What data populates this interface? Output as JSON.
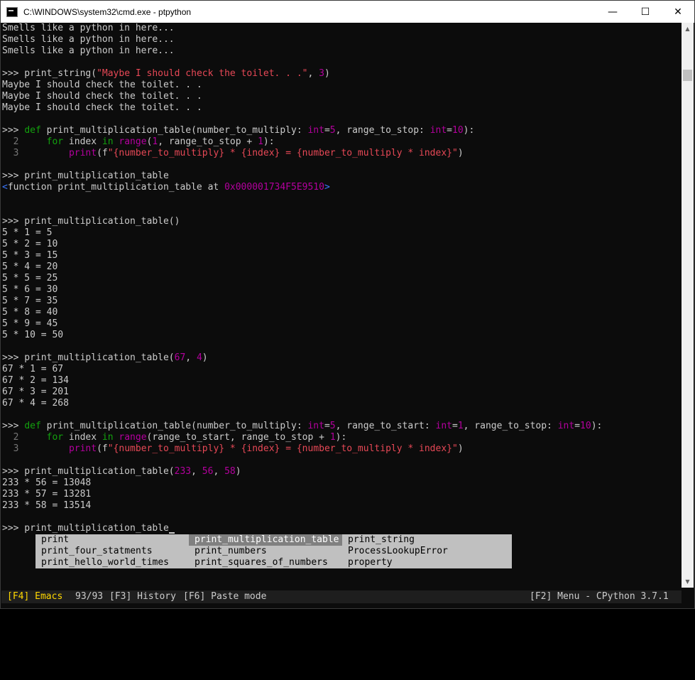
{
  "window": {
    "title": "C:\\WINDOWS\\system32\\cmd.exe - ptpython",
    "minimize": "—",
    "maximize": "☐",
    "close": "✕"
  },
  "terminal": {
    "lines": [
      {
        "segs": [
          {
            "t": "Smells like a python in here..."
          }
        ]
      },
      {
        "segs": [
          {
            "t": "Smells like a python in here..."
          }
        ]
      },
      {
        "segs": [
          {
            "t": "Smells like a python in here..."
          }
        ]
      },
      {
        "segs": []
      },
      {
        "segs": [
          {
            "t": ">>> print_string("
          },
          {
            "t": "\"Maybe I should check the toilet. . .\"",
            "c": "red"
          },
          {
            "t": ", "
          },
          {
            "t": "3",
            "c": "purple"
          },
          {
            "t": ")"
          }
        ]
      },
      {
        "segs": [
          {
            "t": "Maybe I should check the toilet. . ."
          }
        ]
      },
      {
        "segs": [
          {
            "t": "Maybe I should check the toilet. . ."
          }
        ]
      },
      {
        "segs": [
          {
            "t": "Maybe I should check the toilet. . ."
          }
        ]
      },
      {
        "segs": []
      },
      {
        "segs": [
          {
            "t": ">>> "
          },
          {
            "t": "def",
            "c": "green"
          },
          {
            "t": " print_multiplication_table(number_to_multiply: "
          },
          {
            "t": "int",
            "c": "purple"
          },
          {
            "t": "="
          },
          {
            "t": "5",
            "c": "purple"
          },
          {
            "t": ", range_to_stop: "
          },
          {
            "t": "int",
            "c": "purple"
          },
          {
            "t": "="
          },
          {
            "t": "10",
            "c": "purple"
          },
          {
            "t": "):"
          }
        ]
      },
      {
        "segs": [
          {
            "t": "  2",
            "c": "lnum"
          },
          {
            "t": "     "
          },
          {
            "t": "for",
            "c": "green"
          },
          {
            "t": " index "
          },
          {
            "t": "in",
            "c": "green"
          },
          {
            "t": " "
          },
          {
            "t": "range",
            "c": "purple"
          },
          {
            "t": "("
          },
          {
            "t": "1",
            "c": "purple"
          },
          {
            "t": ", range_to_stop + "
          },
          {
            "t": "1",
            "c": "purple"
          },
          {
            "t": "):"
          }
        ]
      },
      {
        "segs": [
          {
            "t": "  3",
            "c": "lnum"
          },
          {
            "t": "         "
          },
          {
            "t": "print",
            "c": "purple"
          },
          {
            "t": "(f"
          },
          {
            "t": "\"{number_to_multiply} * {index} = {number_to_multiply * index}\"",
            "c": "red"
          },
          {
            "t": ")"
          }
        ]
      },
      {
        "segs": []
      },
      {
        "segs": [
          {
            "t": ">>> print_multiplication_table"
          }
        ]
      },
      {
        "segs": [
          {
            "t": "<",
            "c": "blue"
          },
          {
            "t": "function print_multiplication_table at "
          },
          {
            "t": "0x000001734F5E9510",
            "c": "purple"
          },
          {
            "t": ">",
            "c": "blue"
          }
        ]
      },
      {
        "segs": []
      },
      {
        "segs": []
      },
      {
        "segs": [
          {
            "t": ">>> print_multiplication_table()"
          }
        ]
      },
      {
        "segs": [
          {
            "t": "5 * 1 = 5"
          }
        ]
      },
      {
        "segs": [
          {
            "t": "5 * 2 = 10"
          }
        ]
      },
      {
        "segs": [
          {
            "t": "5 * 3 = 15"
          }
        ]
      },
      {
        "segs": [
          {
            "t": "5 * 4 = 20"
          }
        ]
      },
      {
        "segs": [
          {
            "t": "5 * 5 = 25"
          }
        ]
      },
      {
        "segs": [
          {
            "t": "5 * 6 = 30"
          }
        ]
      },
      {
        "segs": [
          {
            "t": "5 * 7 = 35"
          }
        ]
      },
      {
        "segs": [
          {
            "t": "5 * 8 = 40"
          }
        ]
      },
      {
        "segs": [
          {
            "t": "5 * 9 = 45"
          }
        ]
      },
      {
        "segs": [
          {
            "t": "5 * 10 = 50"
          }
        ]
      },
      {
        "segs": []
      },
      {
        "segs": [
          {
            "t": ">>> print_multiplication_table("
          },
          {
            "t": "67",
            "c": "purple"
          },
          {
            "t": ", "
          },
          {
            "t": "4",
            "c": "purple"
          },
          {
            "t": ")"
          }
        ]
      },
      {
        "segs": [
          {
            "t": "67 * 1 = 67"
          }
        ]
      },
      {
        "segs": [
          {
            "t": "67 * 2 = 134"
          }
        ]
      },
      {
        "segs": [
          {
            "t": "67 * 3 = 201"
          }
        ]
      },
      {
        "segs": [
          {
            "t": "67 * 4 = 268"
          }
        ]
      },
      {
        "segs": []
      },
      {
        "segs": [
          {
            "t": ">>> "
          },
          {
            "t": "def",
            "c": "green"
          },
          {
            "t": " print_multiplication_table(number_to_multiply: "
          },
          {
            "t": "int",
            "c": "purple"
          },
          {
            "t": "="
          },
          {
            "t": "5",
            "c": "purple"
          },
          {
            "t": ", range_to_start: "
          },
          {
            "t": "int",
            "c": "purple"
          },
          {
            "t": "="
          },
          {
            "t": "1",
            "c": "purple"
          },
          {
            "t": ", range_to_stop: "
          },
          {
            "t": "int",
            "c": "purple"
          },
          {
            "t": "="
          },
          {
            "t": "10",
            "c": "purple"
          },
          {
            "t": "):"
          }
        ]
      },
      {
        "segs": [
          {
            "t": "  2",
            "c": "lnum"
          },
          {
            "t": "     "
          },
          {
            "t": "for",
            "c": "green"
          },
          {
            "t": " index "
          },
          {
            "t": "in",
            "c": "green"
          },
          {
            "t": " "
          },
          {
            "t": "range",
            "c": "purple"
          },
          {
            "t": "(range_to_start, range_to_stop + "
          },
          {
            "t": "1",
            "c": "purple"
          },
          {
            "t": "):"
          }
        ]
      },
      {
        "segs": [
          {
            "t": "  3",
            "c": "lnum"
          },
          {
            "t": "         "
          },
          {
            "t": "print",
            "c": "purple"
          },
          {
            "t": "(f"
          },
          {
            "t": "\"{number_to_multiply} * {index} = {number_to_multiply * index}\"",
            "c": "red"
          },
          {
            "t": ")"
          }
        ]
      },
      {
        "segs": []
      },
      {
        "segs": [
          {
            "t": ">>> print_multiplication_table("
          },
          {
            "t": "233",
            "c": "purple"
          },
          {
            "t": ", "
          },
          {
            "t": "56",
            "c": "purple"
          },
          {
            "t": ", "
          },
          {
            "t": "58",
            "c": "purple"
          },
          {
            "t": ")"
          }
        ]
      },
      {
        "segs": [
          {
            "t": "233 * 56 = 13048"
          }
        ]
      },
      {
        "segs": [
          {
            "t": "233 * 57 = 13281"
          }
        ]
      },
      {
        "segs": [
          {
            "t": "233 * 58 = 13514"
          }
        ]
      },
      {
        "segs": []
      },
      {
        "segs": [
          {
            "t": ">>> print_multiplication_table"
          }
        ],
        "cursor": true
      }
    ]
  },
  "completion_menu": {
    "columns": [
      [
        "print",
        "print_four_statments",
        "print_hello_world_times"
      ],
      [
        "print_multiplication_table",
        "print_numbers",
        "print_squares_of_numbers"
      ],
      [
        "print_string",
        "ProcessLookupError",
        "property"
      ]
    ],
    "selected": [
      1,
      0
    ]
  },
  "status_bar": {
    "emacs": "[F4] Emacs",
    "position": "93/93",
    "history": "[F3] History",
    "paste": "[F6] Paste mode",
    "menu": "[F2] Menu - CPython 3.7.1"
  },
  "colors": {
    "keyword": "#13a10e",
    "string": "#e74856",
    "number": "#b4009e",
    "bracket": "#3b78ff",
    "status_key": "#ffd700"
  }
}
